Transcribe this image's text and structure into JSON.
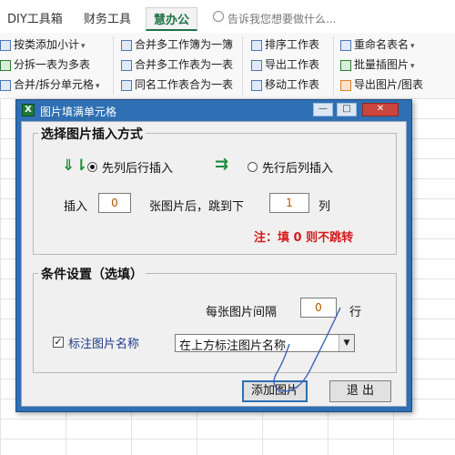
{
  "ribbon": {
    "tabs": [
      "DIY工具箱",
      "财务工具",
      "慧办公"
    ],
    "active_tab": "慧办公",
    "tell_me": "告诉我您想要做什么...",
    "col1": [
      "按类添加小计",
      "分拆一表为多表",
      "合并/拆分单元格"
    ],
    "col2": [
      "合并多工作簿为一簿",
      "合并多工作表为一表",
      "同名工作表合为一表"
    ],
    "col3": [
      "排序工作表",
      "导出工作表",
      "移动工作表"
    ],
    "col4": [
      "重命名表名",
      "批量插图片",
      "导出图片/图表"
    ],
    "accent": "#217346"
  },
  "dialog": {
    "title": "图片填满单元格",
    "title_icon": "X",
    "window_buttons": {
      "minimize": "—",
      "maximize": "□",
      "close": "✕"
    },
    "group1": {
      "title": "选择图片插入方式",
      "option1": "先列后行插入",
      "option2": "先行后列插入",
      "selected": "先列后行插入",
      "insert_label": "插入",
      "insert_value": "0",
      "after_label": "张图片后，跳到下",
      "jump_value": "1",
      "unit_col": "列",
      "note": "注：填 0 则不跳转"
    },
    "group2": {
      "title": "条件设置（选填）",
      "interval_label": "每张图片间隔",
      "interval_value": "0",
      "unit_row": "行",
      "checkbox_label": "标注图片名称",
      "checkbox_checked": true,
      "check_mark": "✓",
      "combo_value": "在上方标注图片名称",
      "combo_arrow": "▼"
    },
    "buttons": {
      "add": "添加图片",
      "exit": "退  出"
    }
  },
  "colors": {
    "titlebar": "#2f6fb3",
    "note": "#d21b1b",
    "number": "#b25400"
  }
}
